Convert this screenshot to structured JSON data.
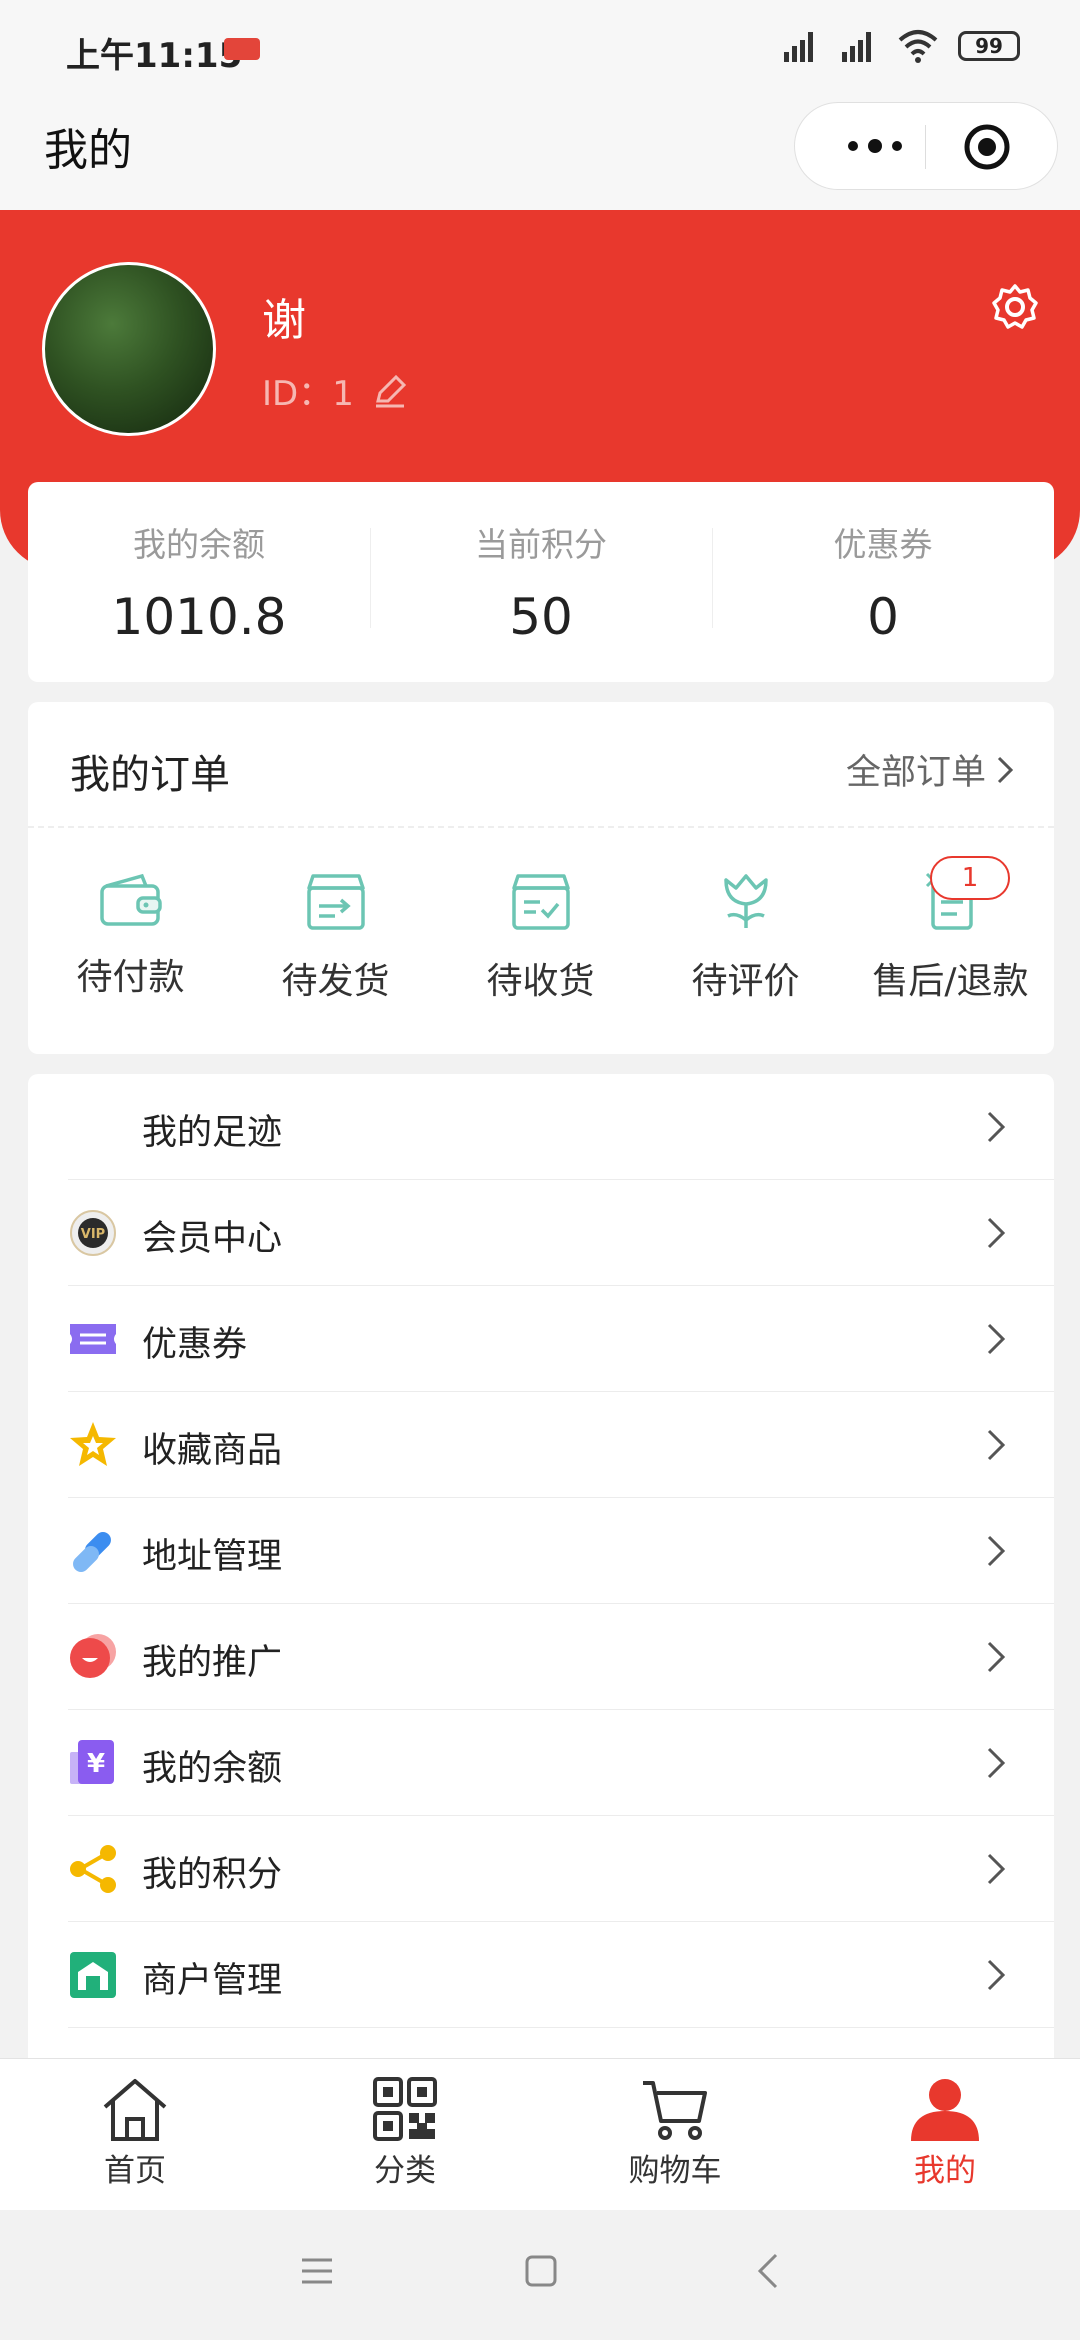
{
  "status_bar": {
    "time": "上午11:15",
    "battery": "99"
  },
  "nav": {
    "title": "我的"
  },
  "profile": {
    "name": "谢",
    "id_text": "ID：1"
  },
  "stats": [
    {
      "label": "我的余额",
      "value": "1010.8"
    },
    {
      "label": "当前积分",
      "value": "50"
    },
    {
      "label": "优惠券",
      "value": "0"
    }
  ],
  "orders": {
    "title": "我的订单",
    "all_label": "全部订单",
    "items": [
      {
        "label": "待付款",
        "icon": "wallet-icon"
      },
      {
        "label": "待发货",
        "icon": "box-send-icon"
      },
      {
        "label": "待收货",
        "icon": "box-check-icon"
      },
      {
        "label": "待评价",
        "icon": "flower-icon"
      },
      {
        "label": "售后/退款",
        "icon": "refund-icon"
      }
    ],
    "refund_badge": "1"
  },
  "menu": [
    {
      "label": "我的足迹",
      "icon": "footprint-icon"
    },
    {
      "label": "会员中心",
      "icon": "vip-icon"
    },
    {
      "label": "优惠券",
      "icon": "coupon-icon"
    },
    {
      "label": "收藏商品",
      "icon": "star-icon"
    },
    {
      "label": "地址管理",
      "icon": "link-icon"
    },
    {
      "label": "我的推广",
      "icon": "promote-icon"
    },
    {
      "label": "我的余额",
      "icon": "yuan-icon"
    },
    {
      "label": "我的积分",
      "icon": "share-icon"
    },
    {
      "label": "商户管理",
      "icon": "merchant-icon"
    }
  ],
  "tabbar": [
    {
      "label": "首页",
      "icon": "home-icon"
    },
    {
      "label": "分类",
      "icon": "qrcode-icon"
    },
    {
      "label": "购物车",
      "icon": "cart-icon"
    },
    {
      "label": "我的",
      "icon": "user-icon"
    }
  ],
  "colors": {
    "accent": "#e8382d",
    "teal": "#6cc5b3"
  }
}
